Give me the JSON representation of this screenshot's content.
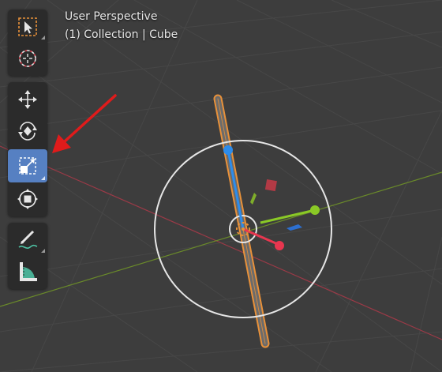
{
  "viewport": {
    "perspective_label": "User Perspective",
    "collection_label": "(1) Collection | Cube"
  },
  "toolbar": {
    "groups": [
      {
        "items": [
          {
            "name": "select-box-tool",
            "icon": "cursor-box-icon",
            "active": false
          },
          {
            "name": "cursor-tool",
            "icon": "3d-cursor-icon",
            "active": false
          }
        ]
      },
      {
        "items": [
          {
            "name": "move-tool",
            "icon": "move-arrows-icon",
            "active": false
          },
          {
            "name": "rotate-tool",
            "icon": "rotate-icon",
            "active": false
          },
          {
            "name": "scale-tool",
            "icon": "scale-icon",
            "active": true
          },
          {
            "name": "transform-tool",
            "icon": "transform-icon",
            "active": false
          }
        ]
      },
      {
        "items": [
          {
            "name": "annotate-tool",
            "icon": "annotate-pencil-icon",
            "active": false
          },
          {
            "name": "measure-tool",
            "icon": "measure-ruler-icon",
            "active": false
          }
        ]
      }
    ]
  },
  "colors": {
    "background": "#3d3d3d",
    "grid": "#474747",
    "x_axis": "#9b3a47",
    "y_axis": "#6a8a2a",
    "selection_outline": "#e8913a",
    "active_tool": "#5680c2",
    "annotation_arrow": "#e01b1b",
    "gizmo_x": "#e8364f",
    "gizmo_y": "#8ac926",
    "gizmo_z": "#2d8ceb"
  }
}
